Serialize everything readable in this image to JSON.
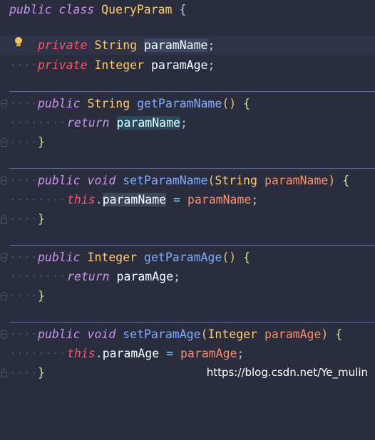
{
  "code": {
    "class_modifier": "public",
    "class_keyword": "class",
    "class_name": "QueryParam",
    "open_brace": "{",
    "field1": {
      "modifier": "private",
      "type": "String",
      "name": "paramName",
      "semi": ";"
    },
    "field2": {
      "modifier": "private",
      "type": "Integer",
      "name": "paramAge",
      "semi": ";"
    },
    "getName": {
      "modifier": "public",
      "type": "String",
      "name": "getParamName",
      "parens": "()",
      "brace": "{",
      "ret": "return",
      "ret_value": "paramName",
      "semi": ";",
      "close": "}"
    },
    "setName": {
      "modifier": "public",
      "void": "void",
      "name": "setParamName",
      "lp": "(",
      "ptype": "String",
      "pname": "paramName",
      "rp": ")",
      "brace": "{",
      "this": "this",
      "dot": ".",
      "field": "paramName",
      "eq": "=",
      "value": "paramName",
      "semi": ";",
      "close": "}"
    },
    "getAge": {
      "modifier": "public",
      "type": "Integer",
      "name": "getParamAge",
      "parens": "()",
      "brace": "{",
      "ret": "return",
      "ret_value": "paramAge",
      "semi": ";",
      "close": "}"
    },
    "setAge": {
      "modifier": "public",
      "void": "void",
      "name": "setParamAge",
      "lp": "(",
      "ptype": "Integer",
      "pname": "paramAge",
      "rp": ")",
      "brace": "{",
      "this": "this",
      "dot": ".",
      "field": "paramAge",
      "eq": "=",
      "value": "paramAge",
      "semi": ";",
      "close": "}"
    }
  },
  "indent_dots": "····",
  "indent_dots_double": "········",
  "icons": {
    "intention": "lightbulb-icon",
    "fold": "fold-marker-icon"
  },
  "watermark": "https://blog.csdn.net/Ye_mulin"
}
